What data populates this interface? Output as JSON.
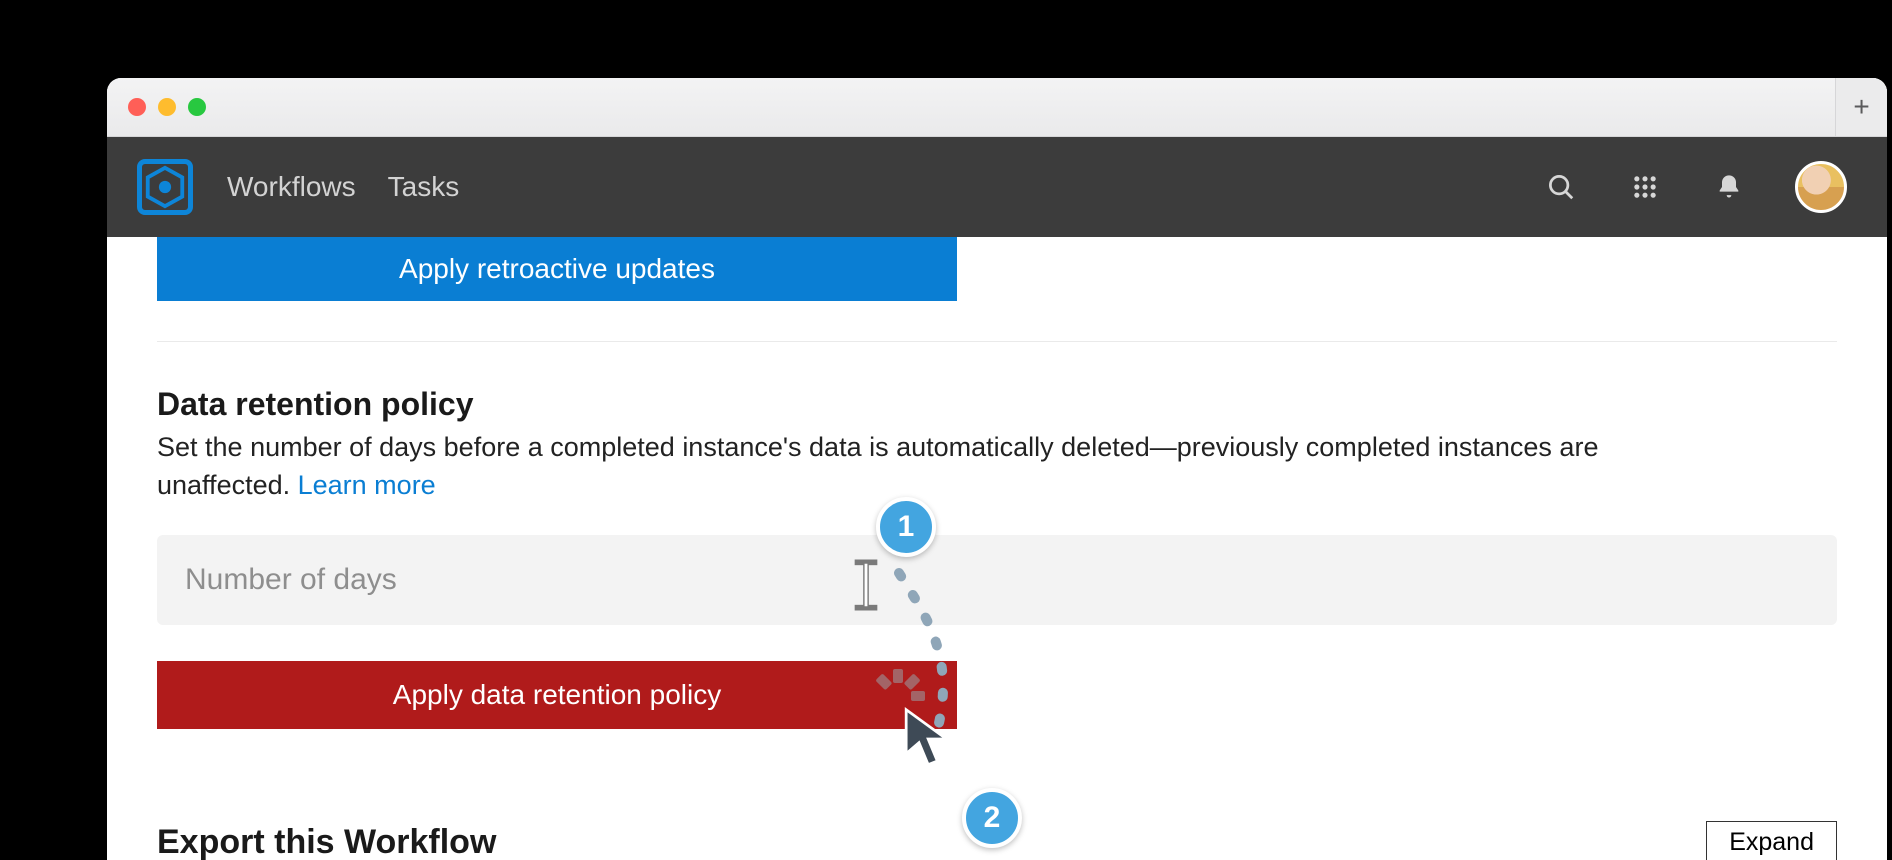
{
  "nav": {
    "workflows_label": "Workflows",
    "tasks_label": "Tasks"
  },
  "retroactive_button_label": "Apply retroactive updates",
  "retention": {
    "title": "Data retention policy",
    "description_prefix": "Set the number of days before a completed instance's data is automatically deleted—previously completed instances are unaffected. ",
    "learn_more_label": "Learn more",
    "input_placeholder": "Number of days",
    "apply_button_label": "Apply data retention policy"
  },
  "export": {
    "title": "Export this Workflow",
    "expand_label": "Expand"
  },
  "annotations": {
    "step1_label": "1",
    "step2_label": "2"
  },
  "colors": {
    "primary_blue": "#0a7ed3",
    "danger_red": "#b01b1b",
    "navbar_bg": "#3c3c3c",
    "badge_blue": "#43a5e0"
  }
}
